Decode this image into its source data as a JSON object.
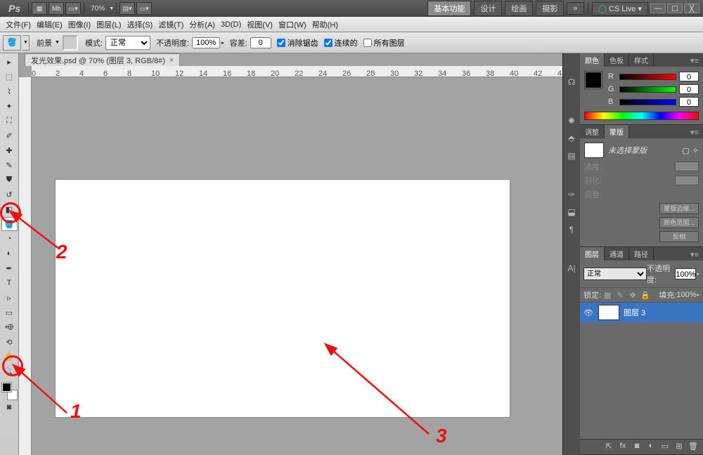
{
  "appbar": {
    "ps": "Ps",
    "mb": "Mb",
    "zoom": "70%",
    "workspace": [
      "基本功能",
      "设计",
      "绘画",
      "摄影"
    ],
    "more": "»",
    "cslive": "CS Live"
  },
  "menubar": [
    "文件(F)",
    "编辑(E)",
    "图像(I)",
    "图层(L)",
    "选择(S)",
    "滤镜(T)",
    "分析(A)",
    "3D(D)",
    "视图(V)",
    "窗口(W)",
    "帮助(H)"
  ],
  "optbar": {
    "fglabel": "前景",
    "modelabel": "模式:",
    "mode": "正常",
    "opacitylabel": "不透明度:",
    "opacity": "100%",
    "tolerancelabel": "容差:",
    "tolerance": "0",
    "cb1": "消除锯齿",
    "cb2": "连续的",
    "cb3": "所有图层"
  },
  "doc": {
    "tab": "发光效果.psd @ 70% (图层 3, RGB/8#)"
  },
  "colorpanel": {
    "tabs": [
      "颜色",
      "色板",
      "样式"
    ],
    "r": "R",
    "g": "G",
    "b": "B",
    "rv": "0",
    "gv": "0",
    "bv": "0"
  },
  "maskpanel": {
    "tabs": [
      "调整",
      "蒙版"
    ],
    "nosel": "未选择蒙版",
    "density": "浓度:",
    "feather": "羽化:",
    "refine": "调整:",
    "b1": "蒙版边缘...",
    "b2": "颜色范围...",
    "b3": "反相"
  },
  "layerpanel": {
    "tabs": [
      "图层",
      "通道",
      "路径"
    ],
    "blend": "正常",
    "opl": "不透明度:",
    "opv": "100%",
    "lockl": "锁定:",
    "filll": "填充:",
    "fillv": "100%",
    "layer": "图层 3"
  },
  "ann": {
    "a1": "1",
    "a2": "2",
    "a3": "3"
  }
}
